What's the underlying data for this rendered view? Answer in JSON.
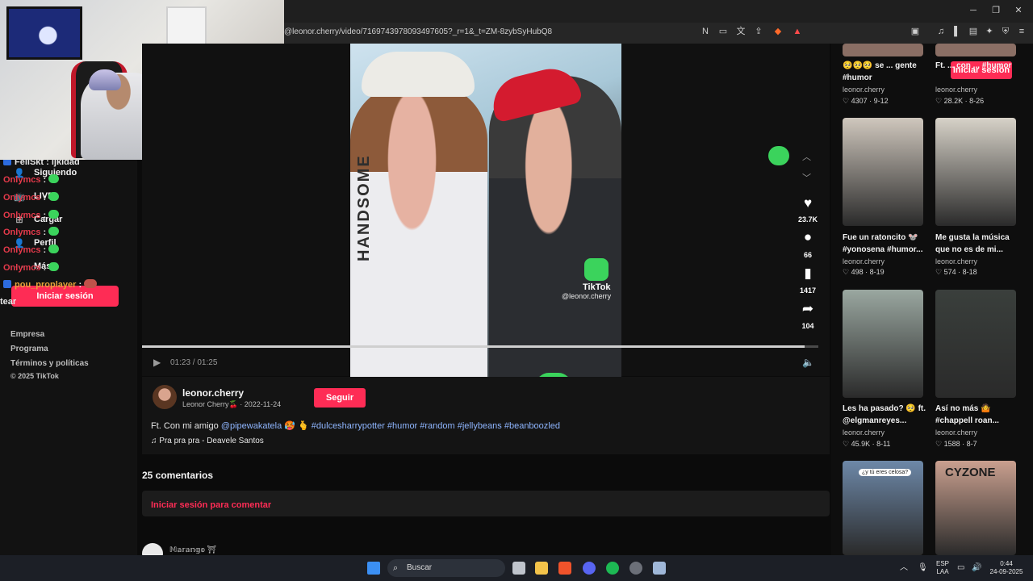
{
  "browser": {
    "url": "@leonor.cherry/video/7169743978093497605?_r=1&_t=ZM-8zybSyHubQ8"
  },
  "sidebar": {
    "nav": [
      {
        "label": "Siguiendo",
        "icon": "person-icon"
      },
      {
        "label": "LIVE",
        "icon": "live-icon"
      },
      {
        "label": "Cargar",
        "icon": "upload-icon"
      },
      {
        "label": "Perfil",
        "icon": "profile-icon"
      },
      {
        "label": "Más",
        "icon": "more-icon"
      }
    ],
    "login_label": "Iniciar sesión",
    "footer": [
      "Empresa",
      "Programa",
      "Términos y políticas",
      "© 2025 TikTok"
    ]
  },
  "chat": [
    {
      "user": "FeliSkt",
      "message": ": ijkidad",
      "color": "#e7e7e7"
    },
    {
      "user": "Onlymcs",
      "message": ":",
      "color": "#e53a4b"
    },
    {
      "user": "Onlymcs",
      "message": ":",
      "color": "#e53a4b"
    },
    {
      "user": "Onlymcs",
      "message": ":",
      "color": "#e53a4b"
    },
    {
      "user": "Onlymcs",
      "message": ":",
      "color": "#e53a4b"
    },
    {
      "user": "Onlymcs",
      "message": ":",
      "color": "#e53a4b"
    },
    {
      "user": "Onlymcs",
      "message": ":",
      "color": "#e53a4b"
    },
    {
      "user": "pou_proplayer",
      "message": ":",
      "color": "#e8a33a"
    }
  ],
  "chat_extra": "tear",
  "video": {
    "time": "01:23 / 01:25",
    "progress": 0.98,
    "handsome_text": "HANDSOME",
    "tiktok_label": "TikTok",
    "watermark_handle": "@leonor.cherry"
  },
  "actions": {
    "likes": "23.7K",
    "comments": "66",
    "saves": "1417",
    "shares": "104"
  },
  "author": {
    "handle": "leonor.cherry",
    "display": "Leonor Cherry🍒 · 2022-11-24",
    "follow_label": "Seguir",
    "caption_plain": "Ft. Con mi amigo ",
    "caption_mention": "@pipewakatela",
    "caption_emoji": " 🥵 🫰 ",
    "caption_tags": "#dulcesharrypotter #humor #random #jellybeans #beanboozled",
    "music": "♫ Pra pra pra - Deavele Santos"
  },
  "comments": {
    "count_label": "25 comentarios",
    "login_prompt": "Iniciar sesión para comentar",
    "first_user": "𝕄𝕒𝕣𝕒𝕟𝕘𝕠 ⛩"
  },
  "recs": {
    "login_label": "Iniciar sesión",
    "top_items": [
      {
        "title": "🥺🥺🥺 se ... gente #humor",
        "user": "leonor.cherry",
        "stats": "♡ 4307 · 9-12"
      },
      {
        "title": "Ft. ... con ... #humor",
        "user": "leonor.cherry",
        "stats": "♡ 28.2K · 8-26"
      }
    ],
    "items": [
      {
        "title": "Fue un ratoncito 🐭 #yonosena #humor...",
        "user": "leonor.cherry",
        "stats": "♡ 498 · 8-19",
        "bg": "#cfc7bd"
      },
      {
        "title": "Me gusta la música que no es de mi...",
        "user": "leonor.cherry",
        "stats": "♡ 574 · 8-18",
        "bg": "#d7d2c8"
      },
      {
        "title": "Les ha pasado? 🥺 ft. @elgmanreyes...",
        "user": "leonor.cherry",
        "stats": "♡ 45.9K · 8-11",
        "bg": "#9aa7a0"
      },
      {
        "title": "Así no más 🤷 #chappell roan...",
        "user": "leonor.cherry",
        "stats": "♡ 1588 · 8-7",
        "bg": "#3a3f3c"
      },
      {
        "title": "",
        "user": "",
        "stats": "",
        "bg": "#6d88a8"
      },
      {
        "title": "",
        "user": "",
        "stats": "",
        "bg": "#caa08f"
      }
    ],
    "overlay_text": [
      "¿y tú eres celosa?",
      "CYZONE"
    ]
  },
  "taskbar": {
    "search": "Buscar",
    "lang": "ESP",
    "lang2": "LAA",
    "time": "0:44",
    "date": "24-09-2025"
  }
}
